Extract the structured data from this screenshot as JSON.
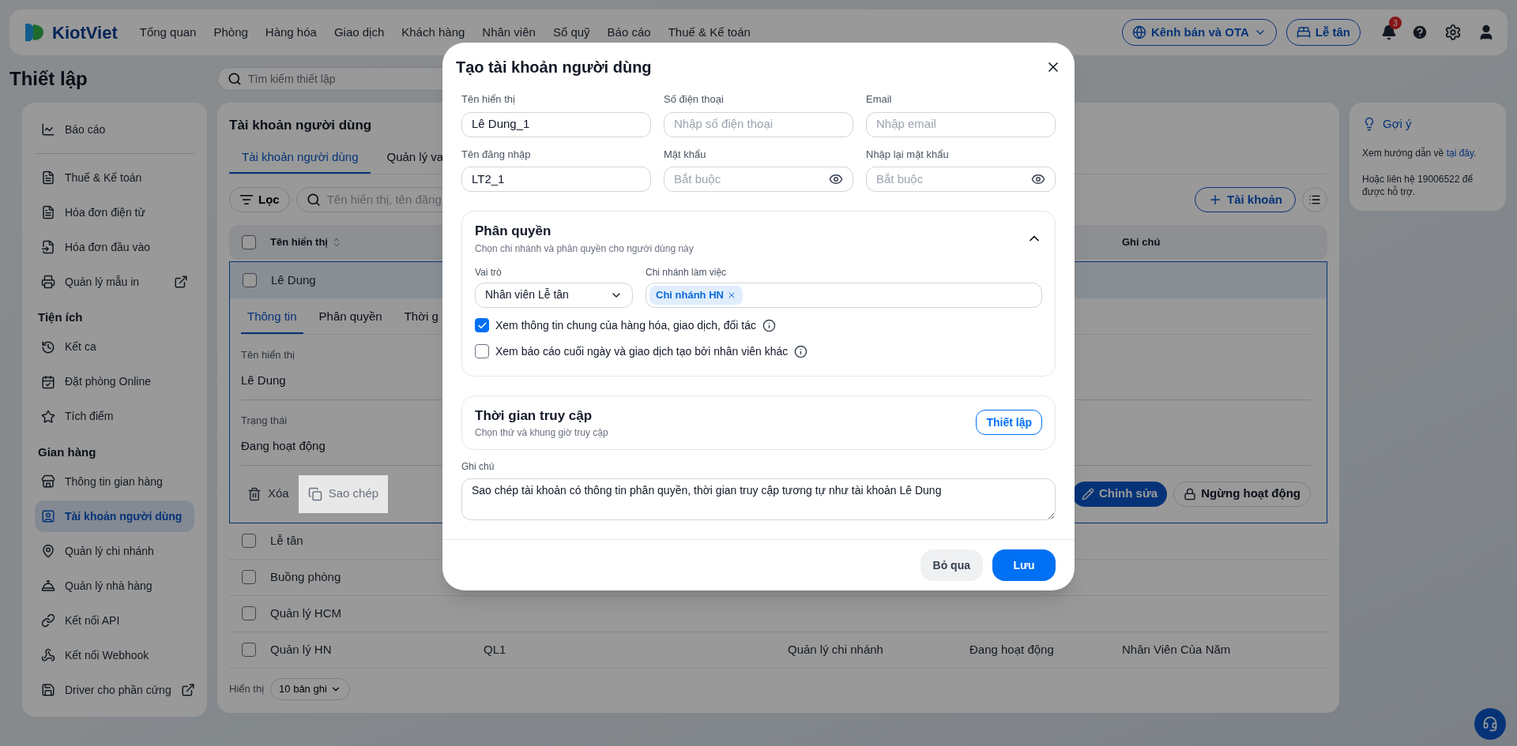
{
  "nav": {
    "logo": "KiotViet",
    "menu": [
      "Tổng quan",
      "Phòng",
      "Hàng hóa",
      "Giao dịch",
      "Khách hàng",
      "Nhân viên",
      "Sổ quỹ",
      "Báo cáo",
      "Thuế & Kế toán"
    ],
    "channel_button": "Kênh bán và OTA",
    "role_button": "Lễ tân",
    "notification_count": "3"
  },
  "page_title": "Thiết lập",
  "settings_search": {
    "placeholder": "Tìm kiếm thiết lập"
  },
  "sidebar": {
    "groups": [
      {
        "items": [
          {
            "label": "Báo cáo",
            "selected": false,
            "external": false
          }
        ]
      },
      {
        "items": [
          {
            "label": "Thuế & Kế toán",
            "selected": false,
            "external": false
          },
          {
            "label": "Hóa đơn điện tử",
            "selected": false,
            "external": false
          },
          {
            "label": "Hóa đơn đầu vào",
            "selected": false,
            "external": false
          },
          {
            "label": "Quản lý mẫu in",
            "selected": false,
            "external": true
          }
        ]
      },
      {
        "heading": "Tiện ích",
        "items": [
          {
            "label": "Kết ca",
            "selected": false,
            "external": false
          },
          {
            "label": "Đặt phòng Online",
            "selected": false,
            "external": false
          },
          {
            "label": "Tích điểm",
            "selected": false,
            "external": false
          }
        ]
      },
      {
        "heading": "Gian hàng",
        "items": [
          {
            "label": "Thông tin gian hàng",
            "selected": false,
            "external": false
          },
          {
            "label": "Tài khoản người dùng",
            "selected": true,
            "external": false
          },
          {
            "label": "Quản lý chi nhánh",
            "selected": false,
            "external": false
          },
          {
            "label": "Quản lý nhà hàng",
            "selected": false,
            "external": false
          },
          {
            "label": "Kết nối API",
            "selected": false,
            "external": false
          },
          {
            "label": "Kết nối Webhook",
            "selected": false,
            "external": false
          },
          {
            "label": "Driver cho phần cứng",
            "selected": false,
            "external": true
          }
        ]
      }
    ]
  },
  "main": {
    "title": "Tài khoản người dùng",
    "tabs": [
      {
        "label": "Tài khoản người dùng",
        "selected": true
      },
      {
        "label": "Quản lý va",
        "selected": false
      }
    ],
    "filter_button": "Lọc",
    "search": {
      "placeholder": "Tên hiển thị, tên đăng"
    },
    "add_button": "Tài khoản",
    "table": {
      "header_checked": false,
      "columns": [
        "Tên hiển thị",
        "",
        "",
        "",
        "Ghi chú"
      ],
      "rows": [
        {
          "cells": [
            "Lê Dung"
          ],
          "checked": false,
          "expanded": true
        },
        {
          "cells": [
            "Lễ tân"
          ],
          "checked": false,
          "expanded": false
        },
        {
          "cells": [
            "Buồng phòng"
          ],
          "checked": false,
          "expanded": false
        },
        {
          "cells": [
            "Quản lý HCM"
          ],
          "checked": false,
          "expanded": false
        },
        {
          "cells": [
            "Quản lý HN",
            "QL1",
            "Quản lý chi nhánh",
            "Đang hoạt động",
            "Nhân Viên Của Năm"
          ],
          "checked": false,
          "expanded": false
        }
      ]
    },
    "detail": {
      "tabs": [
        {
          "label": "Thông tin",
          "selected": true
        },
        {
          "label": "Phân quyền",
          "selected": false
        },
        {
          "label": "Thời g",
          "selected": false
        }
      ],
      "fields": [
        {
          "label": "Tên hiển thị",
          "value": "Lê Dung"
        },
        {
          "label": "Trạng thái",
          "value": "Đang hoạt động"
        }
      ],
      "actions": [
        {
          "label": "Xóa",
          "kind": "delete",
          "highlighted": false
        },
        {
          "label": "Sao chép",
          "kind": "copy",
          "highlighted": true
        }
      ],
      "buttons": [
        {
          "label": "Chỉnh sửa",
          "kind": "edit"
        },
        {
          "label": "Ngừng hoạt động",
          "kind": "lock"
        }
      ]
    },
    "footer": {
      "label": "Hiển thị",
      "page_size": "10 bản ghi"
    }
  },
  "hint": {
    "title": "Gợi ý",
    "text_before": "Xem hướng dẫn về ",
    "link": "tại đây",
    "text_after": ".",
    "contact": "Hoặc liên hệ 19006522 để được hỗ trợ."
  },
  "dialog": {
    "title": "Tạo tài khoản người dùng",
    "fields": [
      {
        "label": "Tên hiển thị",
        "value": "Lê Dung_1",
        "kind": "text"
      },
      {
        "label": "Số điện thoại",
        "placeholder": "Nhập số điện thoại",
        "kind": "text"
      },
      {
        "label": "Email",
        "placeholder": "Nhập email",
        "kind": "text"
      },
      {
        "label": "Tên đăng nhập",
        "value": "LT2_1",
        "kind": "text"
      },
      {
        "label": "Mật khẩu",
        "placeholder": "Bắt buộc",
        "kind": "password"
      },
      {
        "label": "Nhập lại mật khẩu",
        "placeholder": "Bắt buộc",
        "kind": "password"
      }
    ],
    "permissions": {
      "title": "Phân quyền",
      "subtitle": "Chọn chi nhánh và phân quyền cho người dùng này",
      "expanded": true,
      "role": {
        "label": "Vai trò",
        "value": "Nhân viên Lễ tân"
      },
      "branches": {
        "label": "Chi nhánh làm việc",
        "tags": [
          "Chi nhánh HN"
        ]
      },
      "options": [
        {
          "label": "Xem thông tin chung của hàng hóa, giao dịch, đối tác",
          "checked": true
        },
        {
          "label": "Xem báo cáo cuối ngày và giao dịch tạo bởi nhân viên khác",
          "checked": false
        }
      ]
    },
    "access_time": {
      "title": "Thời gian truy cập",
      "subtitle": "Chọn thứ và khung giờ truy cập",
      "button": "Thiết lập"
    },
    "note": {
      "label": "Ghi chú",
      "value": "Sao chép tài khoản có thông tin phân quyền, thời gian truy cập tương tự như tài khoản Lê Dung"
    },
    "buttons": [
      {
        "label": "Bỏ qua",
        "kind": "secondary"
      },
      {
        "label": "Lưu",
        "kind": "primary"
      }
    ]
  }
}
